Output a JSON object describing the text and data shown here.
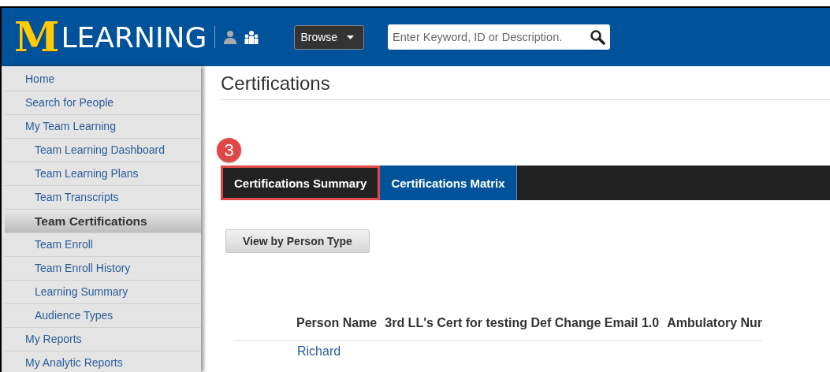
{
  "header": {
    "logo_letter": "M",
    "logo_text": "LEARNING",
    "browse": {
      "label": "Browse"
    },
    "search": {
      "placeholder": "Enter Keyword, ID or Description."
    }
  },
  "sidebar": {
    "items": [
      {
        "label": "Home",
        "selected": false
      },
      {
        "label": "Search for People",
        "selected": false
      },
      {
        "label": "My Team Learning",
        "selected": false,
        "children": [
          {
            "label": "Team Learning Dashboard",
            "selected": false
          },
          {
            "label": "Team Learning Plans",
            "selected": false
          },
          {
            "label": "Team Transcripts",
            "selected": false
          },
          {
            "label": "Team Certifications",
            "selected": true
          },
          {
            "label": "Team Enroll",
            "selected": false
          },
          {
            "label": "Team Enroll History",
            "selected": false
          },
          {
            "label": "Learning Summary",
            "selected": false
          },
          {
            "label": "Audience Types",
            "selected": false
          }
        ]
      },
      {
        "label": "My Reports",
        "selected": false
      },
      {
        "label": "My Analytic Reports",
        "selected": false
      }
    ]
  },
  "page": {
    "title": "Certifications",
    "step_badge": "3",
    "tabs": [
      {
        "label": "Certifications Summary",
        "selected": true,
        "annotated": true
      },
      {
        "label": "Certifications Matrix",
        "selected": false,
        "annotated": false
      }
    ],
    "view_button": "View by Person Type",
    "table": {
      "columns": [
        "Person Name",
        "3rd LL's Cert for testing Def Change Email 1.0",
        "Ambulatory Nur"
      ],
      "rows": [
        [
          "Richard"
        ]
      ]
    }
  }
}
